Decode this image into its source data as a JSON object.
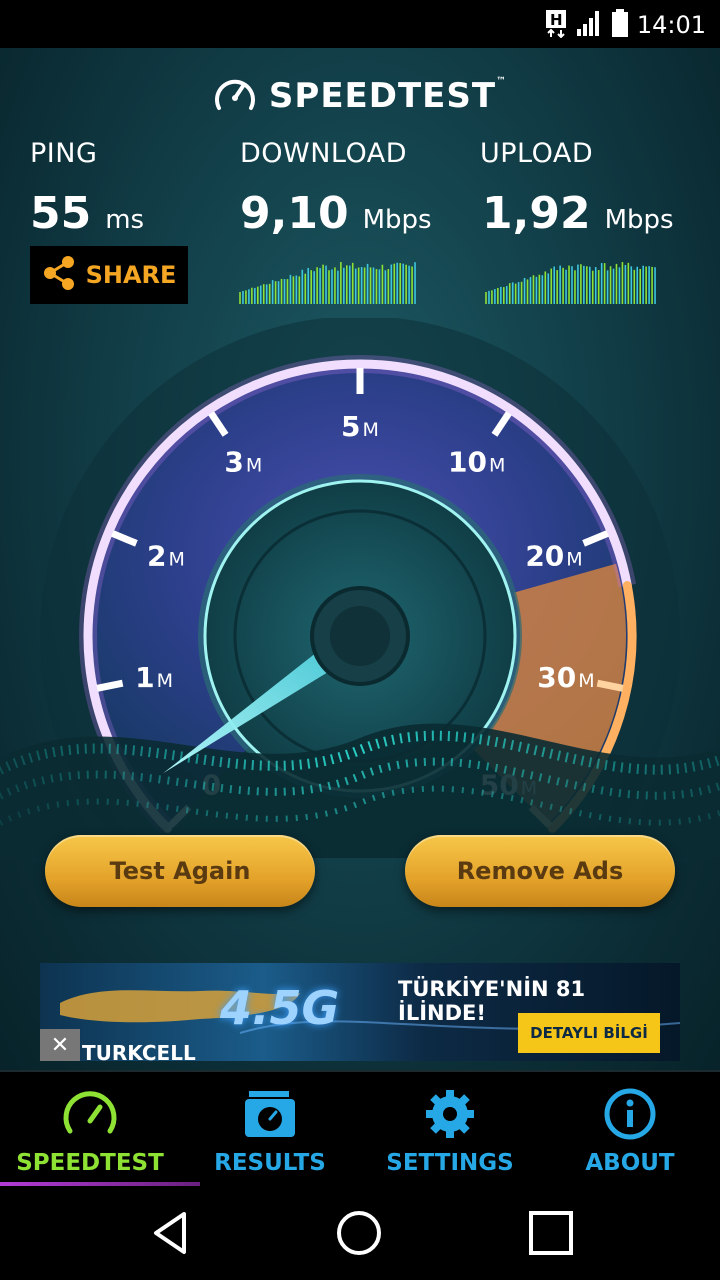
{
  "status_bar": {
    "time": "14:01",
    "icons": [
      "h-plus-data-icon",
      "signal-icon",
      "battery-icon"
    ]
  },
  "brand": {
    "name": "SPEEDTEST",
    "trademark": "™"
  },
  "metrics": {
    "ping": {
      "label": "PING",
      "value": "55",
      "unit": "ms"
    },
    "download": {
      "label": "DOWNLOAD",
      "value": "9,10",
      "unit": "Mbps"
    },
    "upload": {
      "label": "UPLOAD",
      "value": "1,92",
      "unit": "Mbps"
    }
  },
  "share": {
    "label": "SHARE"
  },
  "gauge": {
    "tick_labels": [
      {
        "num": "0",
        "suffix": ""
      },
      {
        "num": "1",
        "suffix": "M"
      },
      {
        "num": "2",
        "suffix": "M"
      },
      {
        "num": "3",
        "suffix": "M"
      },
      {
        "num": "5",
        "suffix": "M"
      },
      {
        "num": "10",
        "suffix": "M"
      },
      {
        "num": "20",
        "suffix": "M"
      },
      {
        "num": "30",
        "suffix": "M"
      },
      {
        "num": "50",
        "suffix": "M"
      }
    ],
    "needle_value_mbps": 0.3
  },
  "buttons": {
    "test_again": "Test Again",
    "remove_ads": "Remove Ads"
  },
  "ad": {
    "headline": "TÜRKİYE'NİN 81 İLİNDE!",
    "cta": "DETAYLI BİLGİ",
    "brand": "TURKCELL",
    "product": "4.5G",
    "close_glyph": "✕"
  },
  "bottom_nav": {
    "items": [
      {
        "label": "SPEEDTEST",
        "icon": "gauge-icon"
      },
      {
        "label": "RESULTS",
        "icon": "results-folder-icon"
      },
      {
        "label": "SETTINGS",
        "icon": "gear-icon"
      },
      {
        "label": "ABOUT",
        "icon": "info-icon"
      }
    ],
    "active": "SPEEDTEST"
  },
  "colors": {
    "accent_green": "#8ee234",
    "accent_blue": "#27a8e6",
    "share_orange": "#f5a623",
    "button_gold": "#e4a32a"
  }
}
